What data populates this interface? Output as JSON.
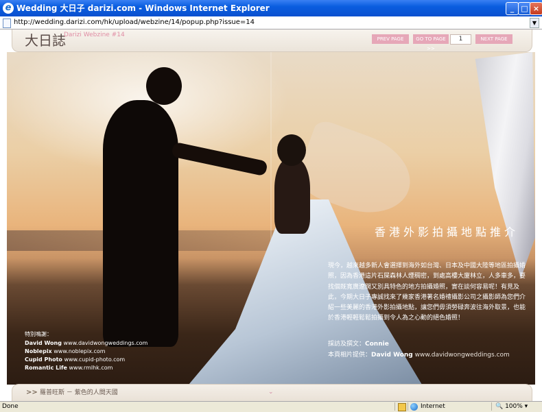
{
  "window": {
    "title": "Wedding 大日子  darizi.com - Windows Internet Explorer",
    "buttons": [
      "_",
      "□",
      "×"
    ]
  },
  "address": {
    "url": "http://wedding.darizi.com/hk/upload/webzine/14/popup.php?issue=14"
  },
  "header": {
    "logo": "大日誌",
    "subtitle": "Darizi Webzine #14",
    "prev_label": "PREV PAGE",
    "goto_label": "GO TO PAGE >>",
    "page_value": "1",
    "next_label": "NEXT PAGE"
  },
  "article": {
    "headline": "香港外影拍攝地點推介",
    "body": "現今，越來越多新人會選擇到海外如台灣、日本及中國大陸等地區拍攝婚照，因為香港這片石屎森林人煙稠密，到處高樓大廈林立，人多車多，要找個既寬廣遼闊又別具特色的地方拍攝婚照，實在談何容易呢！有見及此，今期大日子專誠找來了幾家香港著名婚禮攝影公司之攝影師為您們介紹一些美麗的香港外影拍攝地點，讓您們毋須勞碌奔波往海外取景，也能於香港輕輕鬆鬆拍攝到令人為之心動的絕色婚照！",
    "credit1_label": "採訪及撰文：",
    "credit1_name": "Connie",
    "credit2_label": "本頁相片提供：",
    "credit2_name": "David Wong",
    "credit2_site": "www.davidwongweddings.com"
  },
  "thanks": {
    "title": "特別鳴謝：",
    "rows": [
      {
        "name": "David Wong",
        "site": "www.davidwongweddings.com"
      },
      {
        "name": "Noblepix",
        "site": "www.noblepix.com"
      },
      {
        "name": "Cupid Photo",
        "site": "www.cupid-photo.com"
      },
      {
        "name": "Romantic Life",
        "site": "www.rmlhk.com"
      }
    ]
  },
  "bottombar": {
    "arrows": ">>",
    "text": "羅普旺斯 － 紫色的人間天國",
    "chevron": "⌄"
  },
  "statusbar": {
    "done": "Done",
    "zone": "Internet",
    "zoom": "100%"
  },
  "icons": {
    "ie": "ie-icon",
    "page": "page-icon",
    "globe": "globe-icon",
    "zoom": "zoom-icon"
  }
}
